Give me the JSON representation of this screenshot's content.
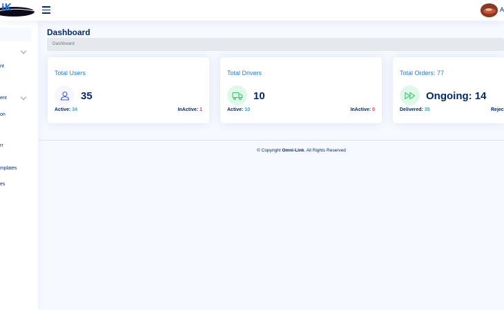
{
  "header": {
    "logo_text": "iK",
    "user_initial": "A"
  },
  "sidebar": {
    "items": [
      {
        "label": "nt"
      },
      {
        "label": "ent"
      },
      {
        "label": "on"
      },
      {
        "label": "rr"
      },
      {
        "label": "mplates"
      },
      {
        "label": "es"
      }
    ]
  },
  "page": {
    "title": "Dashboard",
    "breadcrumb": "Dashboard"
  },
  "cards": [
    {
      "title": "Total Users",
      "value": "35",
      "left_label": "Active:",
      "left_value": "34",
      "right_label": "InActive:",
      "right_value": "1",
      "icon": "user-icon",
      "icon_color": "#4154f1",
      "icon_bg": "#f6f6fe"
    },
    {
      "title": "Total Drivers",
      "value": "10",
      "left_label": "Active:",
      "left_value": "10",
      "right_label": "InActive:",
      "right_value": "0",
      "icon": "truck-icon",
      "icon_color": "#2eca6a",
      "icon_bg": "#e0f8e9"
    },
    {
      "title": "Total Orders: 77",
      "value": "Ongoing: 14",
      "left_label": "Delivered:",
      "left_value": "35",
      "right_label": "Rejec",
      "right_value": "",
      "icon": "fast-forward-icon",
      "icon_color": "#2eca6a",
      "icon_bg": "#e0f8e9"
    }
  ],
  "footer": {
    "prefix": "© Copyright",
    "brand": "Omni-Link",
    "suffix": ". All Rights Reserved"
  }
}
